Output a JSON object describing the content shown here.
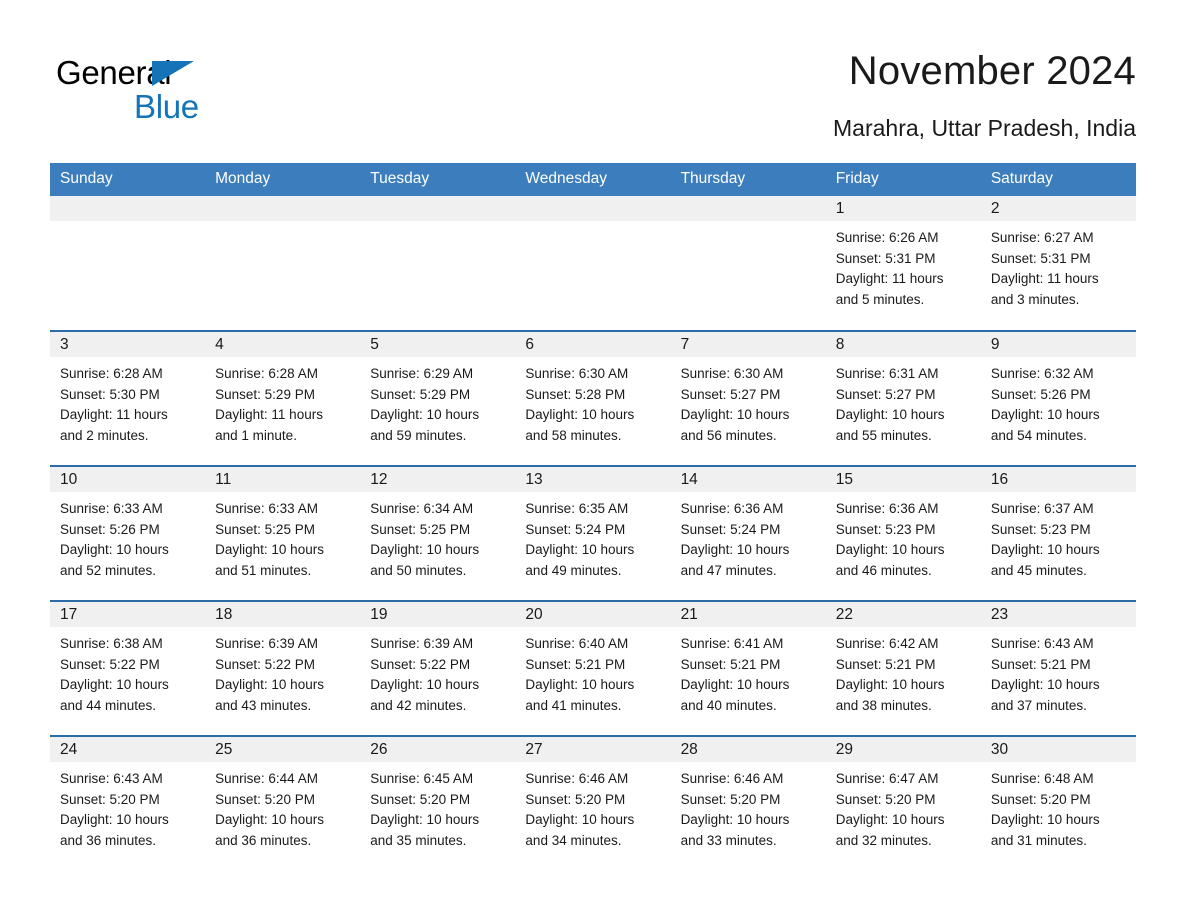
{
  "brand": {
    "name_part1": "General",
    "name_part2": "Blue",
    "accent_color": "#1574b8",
    "triangle_icon": "triangle-icon"
  },
  "header": {
    "title": "November 2024",
    "location": "Marahra, Uttar Pradesh, India"
  },
  "calendar": {
    "header_bg": "#3c7ebd",
    "row_separator_color": "#2b6ca8",
    "daynum_band_bg": "#f0f0f0",
    "weekday_headers": [
      "Sunday",
      "Monday",
      "Tuesday",
      "Wednesday",
      "Thursday",
      "Friday",
      "Saturday"
    ],
    "weeks": [
      [
        {
          "day": "",
          "sunrise": "",
          "sunset": "",
          "daylight_line1": "",
          "daylight_line2": "",
          "empty": true
        },
        {
          "day": "",
          "sunrise": "",
          "sunset": "",
          "daylight_line1": "",
          "daylight_line2": "",
          "empty": true
        },
        {
          "day": "",
          "sunrise": "",
          "sunset": "",
          "daylight_line1": "",
          "daylight_line2": "",
          "empty": true
        },
        {
          "day": "",
          "sunrise": "",
          "sunset": "",
          "daylight_line1": "",
          "daylight_line2": "",
          "empty": true
        },
        {
          "day": "",
          "sunrise": "",
          "sunset": "",
          "daylight_line1": "",
          "daylight_line2": "",
          "empty": true
        },
        {
          "day": "1",
          "sunrise": "Sunrise: 6:26 AM",
          "sunset": "Sunset: 5:31 PM",
          "daylight_line1": "Daylight: 11 hours",
          "daylight_line2": "and 5 minutes.",
          "empty": false
        },
        {
          "day": "2",
          "sunrise": "Sunrise: 6:27 AM",
          "sunset": "Sunset: 5:31 PM",
          "daylight_line1": "Daylight: 11 hours",
          "daylight_line2": "and 3 minutes.",
          "empty": false
        }
      ],
      [
        {
          "day": "3",
          "sunrise": "Sunrise: 6:28 AM",
          "sunset": "Sunset: 5:30 PM",
          "daylight_line1": "Daylight: 11 hours",
          "daylight_line2": "and 2 minutes.",
          "empty": false
        },
        {
          "day": "4",
          "sunrise": "Sunrise: 6:28 AM",
          "sunset": "Sunset: 5:29 PM",
          "daylight_line1": "Daylight: 11 hours",
          "daylight_line2": "and 1 minute.",
          "empty": false
        },
        {
          "day": "5",
          "sunrise": "Sunrise: 6:29 AM",
          "sunset": "Sunset: 5:29 PM",
          "daylight_line1": "Daylight: 10 hours",
          "daylight_line2": "and 59 minutes.",
          "empty": false
        },
        {
          "day": "6",
          "sunrise": "Sunrise: 6:30 AM",
          "sunset": "Sunset: 5:28 PM",
          "daylight_line1": "Daylight: 10 hours",
          "daylight_line2": "and 58 minutes.",
          "empty": false
        },
        {
          "day": "7",
          "sunrise": "Sunrise: 6:30 AM",
          "sunset": "Sunset: 5:27 PM",
          "daylight_line1": "Daylight: 10 hours",
          "daylight_line2": "and 56 minutes.",
          "empty": false
        },
        {
          "day": "8",
          "sunrise": "Sunrise: 6:31 AM",
          "sunset": "Sunset: 5:27 PM",
          "daylight_line1": "Daylight: 10 hours",
          "daylight_line2": "and 55 minutes.",
          "empty": false
        },
        {
          "day": "9",
          "sunrise": "Sunrise: 6:32 AM",
          "sunset": "Sunset: 5:26 PM",
          "daylight_line1": "Daylight: 10 hours",
          "daylight_line2": "and 54 minutes.",
          "empty": false
        }
      ],
      [
        {
          "day": "10",
          "sunrise": "Sunrise: 6:33 AM",
          "sunset": "Sunset: 5:26 PM",
          "daylight_line1": "Daylight: 10 hours",
          "daylight_line2": "and 52 minutes.",
          "empty": false
        },
        {
          "day": "11",
          "sunrise": "Sunrise: 6:33 AM",
          "sunset": "Sunset: 5:25 PM",
          "daylight_line1": "Daylight: 10 hours",
          "daylight_line2": "and 51 minutes.",
          "empty": false
        },
        {
          "day": "12",
          "sunrise": "Sunrise: 6:34 AM",
          "sunset": "Sunset: 5:25 PM",
          "daylight_line1": "Daylight: 10 hours",
          "daylight_line2": "and 50 minutes.",
          "empty": false
        },
        {
          "day": "13",
          "sunrise": "Sunrise: 6:35 AM",
          "sunset": "Sunset: 5:24 PM",
          "daylight_line1": "Daylight: 10 hours",
          "daylight_line2": "and 49 minutes.",
          "empty": false
        },
        {
          "day": "14",
          "sunrise": "Sunrise: 6:36 AM",
          "sunset": "Sunset: 5:24 PM",
          "daylight_line1": "Daylight: 10 hours",
          "daylight_line2": "and 47 minutes.",
          "empty": false
        },
        {
          "day": "15",
          "sunrise": "Sunrise: 6:36 AM",
          "sunset": "Sunset: 5:23 PM",
          "daylight_line1": "Daylight: 10 hours",
          "daylight_line2": "and 46 minutes.",
          "empty": false
        },
        {
          "day": "16",
          "sunrise": "Sunrise: 6:37 AM",
          "sunset": "Sunset: 5:23 PM",
          "daylight_line1": "Daylight: 10 hours",
          "daylight_line2": "and 45 minutes.",
          "empty": false
        }
      ],
      [
        {
          "day": "17",
          "sunrise": "Sunrise: 6:38 AM",
          "sunset": "Sunset: 5:22 PM",
          "daylight_line1": "Daylight: 10 hours",
          "daylight_line2": "and 44 minutes.",
          "empty": false
        },
        {
          "day": "18",
          "sunrise": "Sunrise: 6:39 AM",
          "sunset": "Sunset: 5:22 PM",
          "daylight_line1": "Daylight: 10 hours",
          "daylight_line2": "and 43 minutes.",
          "empty": false
        },
        {
          "day": "19",
          "sunrise": "Sunrise: 6:39 AM",
          "sunset": "Sunset: 5:22 PM",
          "daylight_line1": "Daylight: 10 hours",
          "daylight_line2": "and 42 minutes.",
          "empty": false
        },
        {
          "day": "20",
          "sunrise": "Sunrise: 6:40 AM",
          "sunset": "Sunset: 5:21 PM",
          "daylight_line1": "Daylight: 10 hours",
          "daylight_line2": "and 41 minutes.",
          "empty": false
        },
        {
          "day": "21",
          "sunrise": "Sunrise: 6:41 AM",
          "sunset": "Sunset: 5:21 PM",
          "daylight_line1": "Daylight: 10 hours",
          "daylight_line2": "and 40 minutes.",
          "empty": false
        },
        {
          "day": "22",
          "sunrise": "Sunrise: 6:42 AM",
          "sunset": "Sunset: 5:21 PM",
          "daylight_line1": "Daylight: 10 hours",
          "daylight_line2": "and 38 minutes.",
          "empty": false
        },
        {
          "day": "23",
          "sunrise": "Sunrise: 6:43 AM",
          "sunset": "Sunset: 5:21 PM",
          "daylight_line1": "Daylight: 10 hours",
          "daylight_line2": "and 37 minutes.",
          "empty": false
        }
      ],
      [
        {
          "day": "24",
          "sunrise": "Sunrise: 6:43 AM",
          "sunset": "Sunset: 5:20 PM",
          "daylight_line1": "Daylight: 10 hours",
          "daylight_line2": "and 36 minutes.",
          "empty": false
        },
        {
          "day": "25",
          "sunrise": "Sunrise: 6:44 AM",
          "sunset": "Sunset: 5:20 PM",
          "daylight_line1": "Daylight: 10 hours",
          "daylight_line2": "and 36 minutes.",
          "empty": false
        },
        {
          "day": "26",
          "sunrise": "Sunrise: 6:45 AM",
          "sunset": "Sunset: 5:20 PM",
          "daylight_line1": "Daylight: 10 hours",
          "daylight_line2": "and 35 minutes.",
          "empty": false
        },
        {
          "day": "27",
          "sunrise": "Sunrise: 6:46 AM",
          "sunset": "Sunset: 5:20 PM",
          "daylight_line1": "Daylight: 10 hours",
          "daylight_line2": "and 34 minutes.",
          "empty": false
        },
        {
          "day": "28",
          "sunrise": "Sunrise: 6:46 AM",
          "sunset": "Sunset: 5:20 PM",
          "daylight_line1": "Daylight: 10 hours",
          "daylight_line2": "and 33 minutes.",
          "empty": false
        },
        {
          "day": "29",
          "sunrise": "Sunrise: 6:47 AM",
          "sunset": "Sunset: 5:20 PM",
          "daylight_line1": "Daylight: 10 hours",
          "daylight_line2": "and 32 minutes.",
          "empty": false
        },
        {
          "day": "30",
          "sunrise": "Sunrise: 6:48 AM",
          "sunset": "Sunset: 5:20 PM",
          "daylight_line1": "Daylight: 10 hours",
          "daylight_line2": "and 31 minutes.",
          "empty": false
        }
      ]
    ]
  }
}
